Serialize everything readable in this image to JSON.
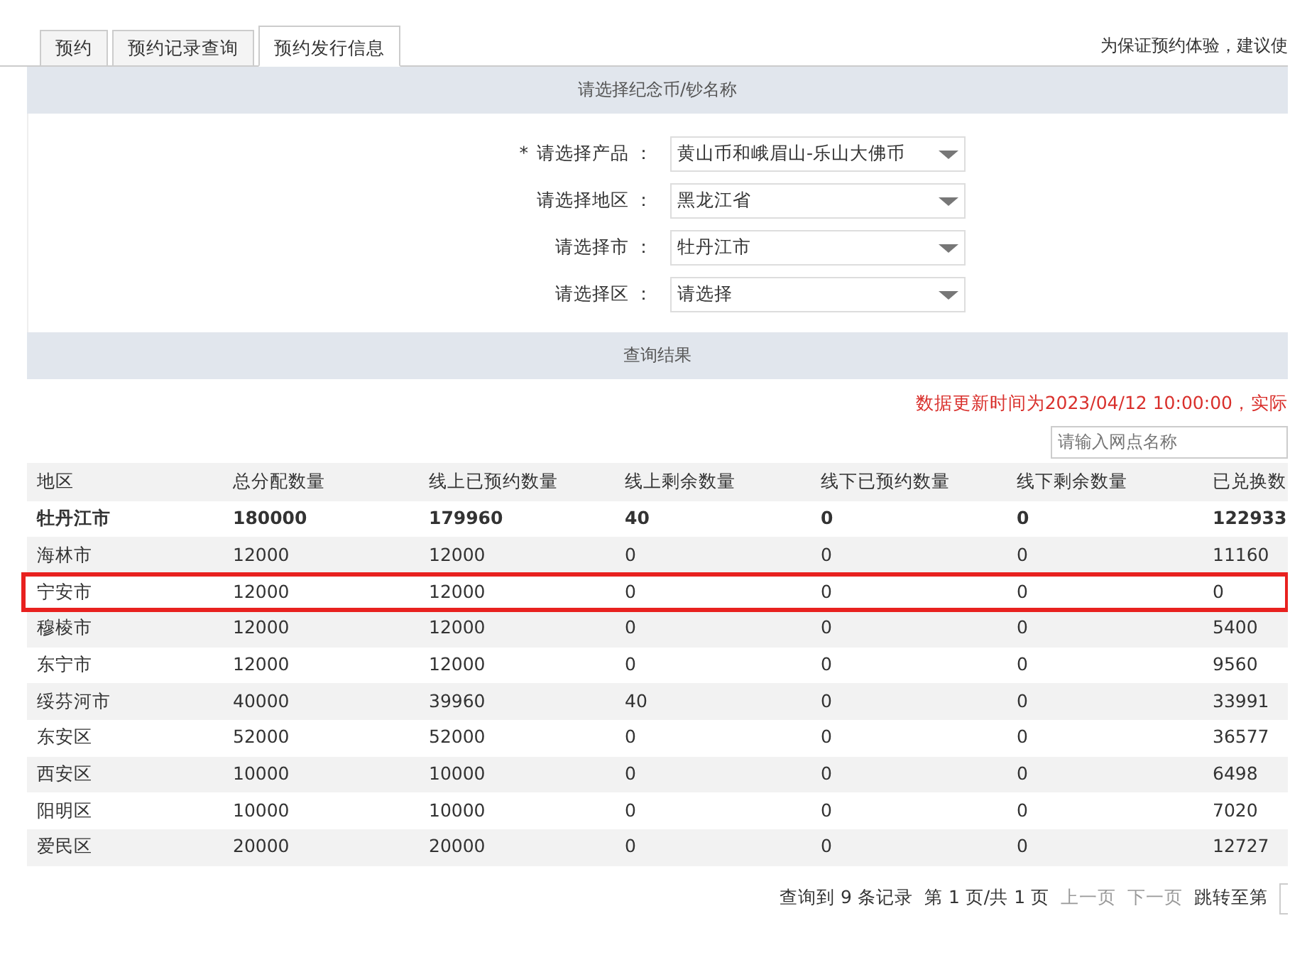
{
  "tabs": [
    {
      "label": "预约",
      "selected": false
    },
    {
      "label": "预约记录查询",
      "selected": false
    },
    {
      "label": "预约发行信息",
      "selected": true
    }
  ],
  "notice": "为保证预约体验，建议使",
  "select_panel": {
    "title": "请选择纪念币/钞名称",
    "fields": [
      {
        "required_mark": "*",
        "label": "请选择产品 ：",
        "value": "黄山币和峨眉山-乐山大佛币"
      },
      {
        "label": "请选择地区 ：",
        "value": "黑龙江省"
      },
      {
        "label": "请选择市 ：",
        "value": "牡丹江市"
      },
      {
        "label": "请选择区 ：",
        "value": "请选择"
      }
    ]
  },
  "results_panel": {
    "title": "查询结果"
  },
  "update_notice": "数据更新时间为2023/04/12 10:00:00，实际",
  "search": {
    "placeholder": "请输入网点名称"
  },
  "table": {
    "columns": [
      "地区",
      "总分配数量",
      "线上已预约数量",
      "线上剩余数量",
      "线下已预约数量",
      "线下剩余数量",
      "已兑换数"
    ],
    "rows": [
      {
        "cells": [
          "牡丹江市",
          "180000",
          "179960",
          "40",
          "0",
          "0",
          "122933"
        ],
        "bold": true,
        "highlighted": false
      },
      {
        "cells": [
          "海林市",
          "12000",
          "12000",
          "0",
          "0",
          "0",
          "11160"
        ],
        "bold": false,
        "highlighted": false
      },
      {
        "cells": [
          "宁安市",
          "12000",
          "12000",
          "0",
          "0",
          "0",
          "0"
        ],
        "bold": false,
        "highlighted": true
      },
      {
        "cells": [
          "穆棱市",
          "12000",
          "12000",
          "0",
          "0",
          "0",
          "5400"
        ],
        "bold": false,
        "highlighted": false
      },
      {
        "cells": [
          "东宁市",
          "12000",
          "12000",
          "0",
          "0",
          "0",
          "9560"
        ],
        "bold": false,
        "highlighted": false
      },
      {
        "cells": [
          "绥芬河市",
          "40000",
          "39960",
          "40",
          "0",
          "0",
          "33991"
        ],
        "bold": false,
        "highlighted": false
      },
      {
        "cells": [
          "东安区",
          "52000",
          "52000",
          "0",
          "0",
          "0",
          "36577"
        ],
        "bold": false,
        "highlighted": false
      },
      {
        "cells": [
          "西安区",
          "10000",
          "10000",
          "0",
          "0",
          "0",
          "6498"
        ],
        "bold": false,
        "highlighted": false
      },
      {
        "cells": [
          "阳明区",
          "10000",
          "10000",
          "0",
          "0",
          "0",
          "7020"
        ],
        "bold": false,
        "highlighted": false
      },
      {
        "cells": [
          "爱民区",
          "20000",
          "20000",
          "0",
          "0",
          "0",
          "12727"
        ],
        "bold": false,
        "highlighted": false
      }
    ]
  },
  "pagination": {
    "summary": "查询到 9 条记录",
    "page": "第 1 页/共 1 页",
    "buttons": [
      {
        "label": "上一页",
        "disabled": true
      },
      {
        "label": "下一页",
        "disabled": true
      }
    ],
    "jump_label": "跳转至第"
  }
}
